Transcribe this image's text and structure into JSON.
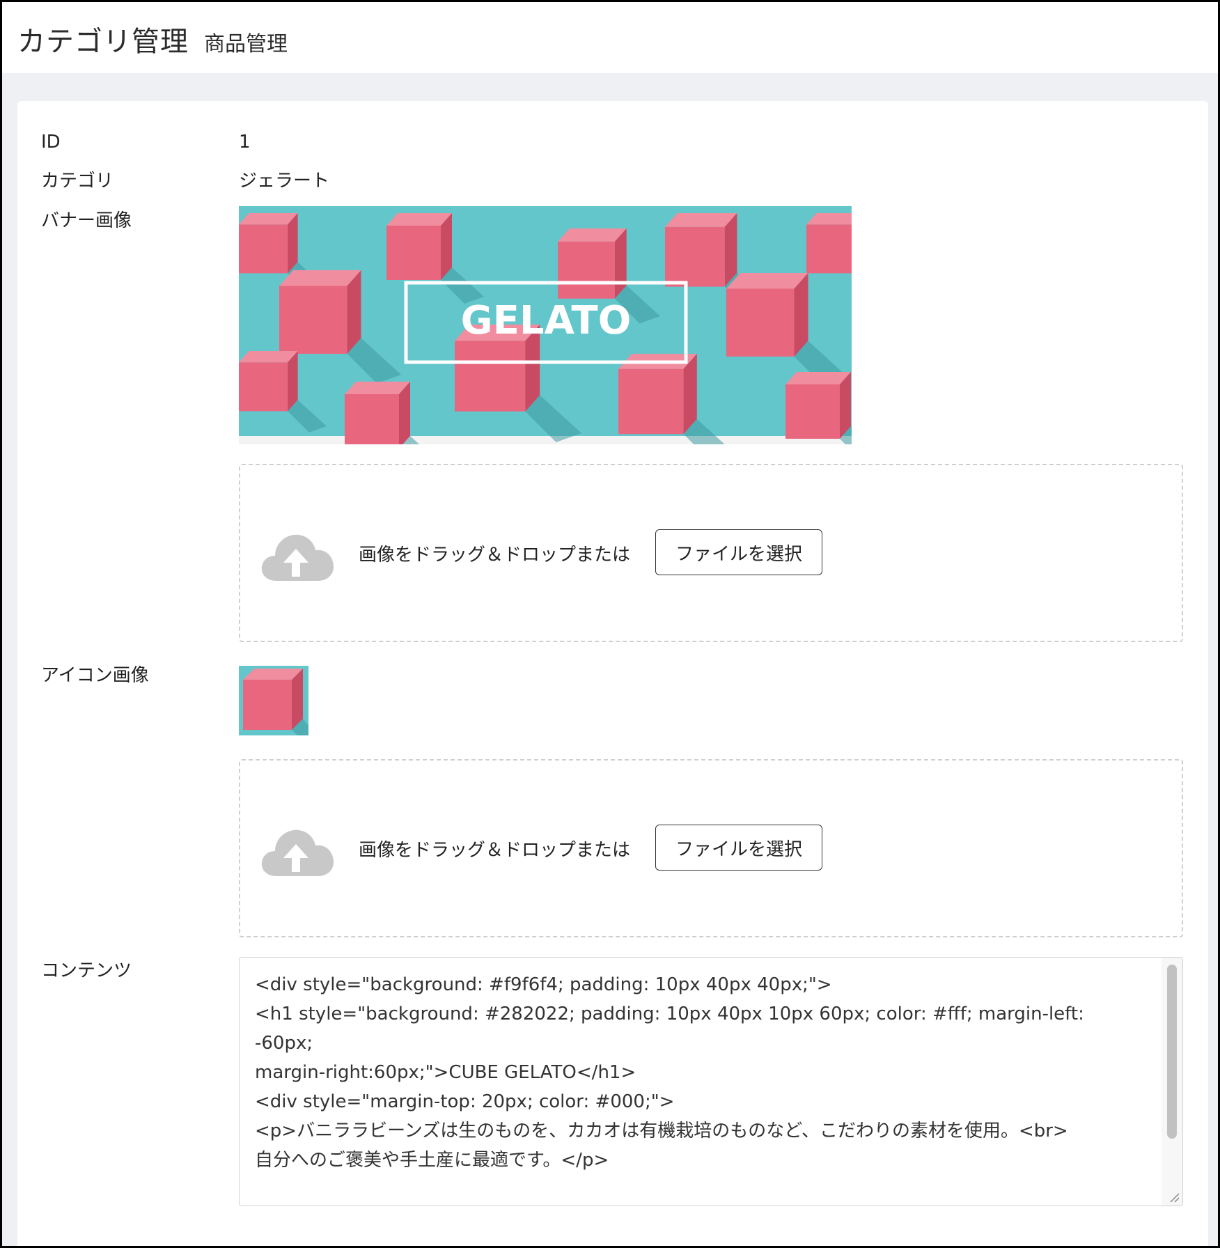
{
  "header": {
    "title": "カテゴリ管理",
    "subtitle": "商品管理"
  },
  "fields": {
    "id_label": "ID",
    "id_value": "1",
    "category_label": "カテゴリ",
    "category_value": "ジェラート",
    "banner_label": "バナー画像",
    "banner_text": "GELATO",
    "icon_label": "アイコン画像",
    "content_label": "コンテンツ"
  },
  "dropzone": {
    "text": "画像をドラッグ＆ドロップまたは",
    "button_label": "ファイルを選択"
  },
  "content": {
    "value": "<div style=\"background: #f9f6f4; padding: 10px 40px 40px;\">\n<h1 style=\"background: #282022; padding: 10px 40px 10px 60px; color: #fff; margin-left: -60px;\nmargin-right:60px;\">CUBE GELATO</h1>\n<div style=\"margin-top: 20px; color: #000;\">\n<p>バニララビーンズは生のものを、カカオは有機栽培のものなど、こだわりの素材を使用。<br>\n自分へのご褒美や手土産に最適です。</p>\n\n</div>"
  },
  "colors": {
    "banner_bg": "#62c6cb",
    "gelato_pink": "#e8677f",
    "cloud_gray": "#c8c8c8"
  },
  "icons": {
    "upload": "cloud-upload-icon"
  }
}
